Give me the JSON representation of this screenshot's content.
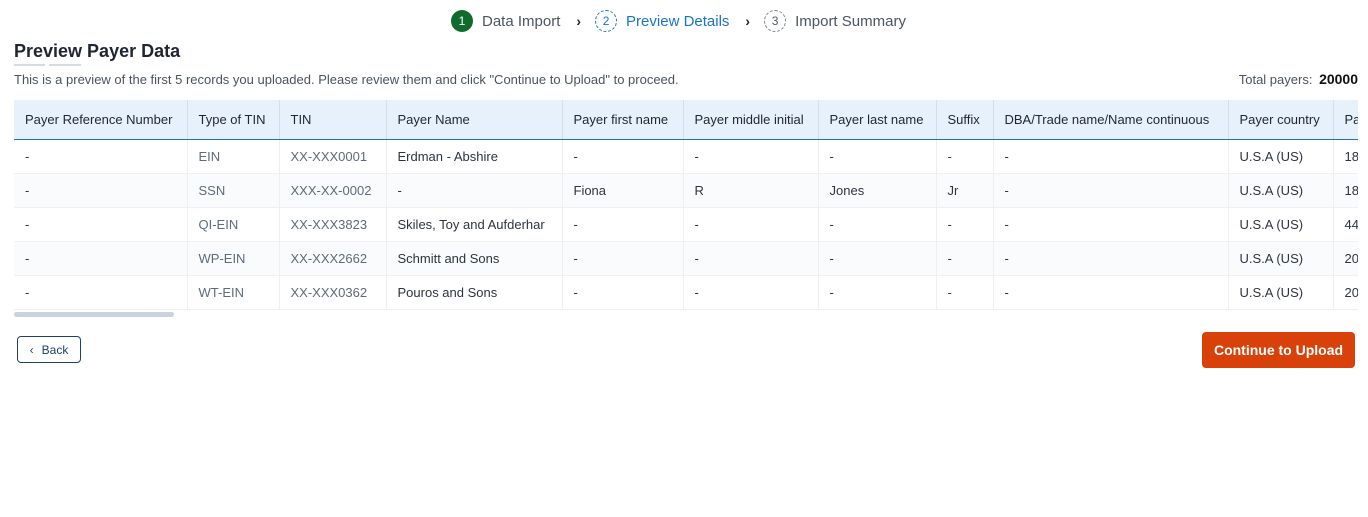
{
  "stepper": {
    "steps": [
      {
        "number": "1",
        "label": "Data Import",
        "state": "completed"
      },
      {
        "number": "2",
        "label": "Preview Details",
        "state": "active"
      },
      {
        "number": "3",
        "label": "Import Summary",
        "state": "pending"
      }
    ],
    "separator_icon": "chevron-right-icon"
  },
  "header": {
    "title": "Preview Payer Data",
    "subtitle": "This is a preview of the first 5 records you uploaded. Please review them and click \"Continue to Upload\" to proceed.",
    "total_label": "Total payers:",
    "total_value": "20000"
  },
  "table": {
    "columns": [
      "Payer Reference Number",
      "Type of TIN",
      "TIN",
      "Payer Name",
      "Payer first name",
      "Payer middle initial",
      "Payer last name",
      "Suffix",
      "DBA/Trade name/Name continuous",
      "Payer country",
      "Pa"
    ],
    "rows": [
      [
        "-",
        "EIN",
        "XX-XXX0001",
        "Erdman - Abshire",
        "-",
        "-",
        "-",
        "-",
        "-",
        "U.S.A (US)",
        "18"
      ],
      [
        "-",
        "SSN",
        "XXX-XX-0002",
        "-",
        "Fiona",
        "R",
        "Jones",
        "Jr",
        "-",
        "U.S.A (US)",
        "18"
      ],
      [
        "-",
        "QI-EIN",
        "XX-XXX3823",
        "Skiles, Toy and Aufderhar",
        "-",
        "-",
        "-",
        "-",
        "-",
        "U.S.A (US)",
        "44"
      ],
      [
        "-",
        "WP-EIN",
        "XX-XXX2662",
        "Schmitt and Sons",
        "-",
        "-",
        "-",
        "-",
        "-",
        "U.S.A (US)",
        "20"
      ],
      [
        "-",
        "WT-EIN",
        "XX-XXX0362",
        "Pouros and Sons",
        "-",
        "-",
        "-",
        "-",
        "-",
        "U.S.A (US)",
        "20"
      ]
    ]
  },
  "actions": {
    "back_label": "Back",
    "back_icon": "chevron-left-icon",
    "continue_label": "Continue to Upload"
  },
  "colors": {
    "completed": "#0f6b2d",
    "active": "#1a73c8",
    "primary_button": "#d9410a",
    "header_bg": "#e7f1fb"
  }
}
